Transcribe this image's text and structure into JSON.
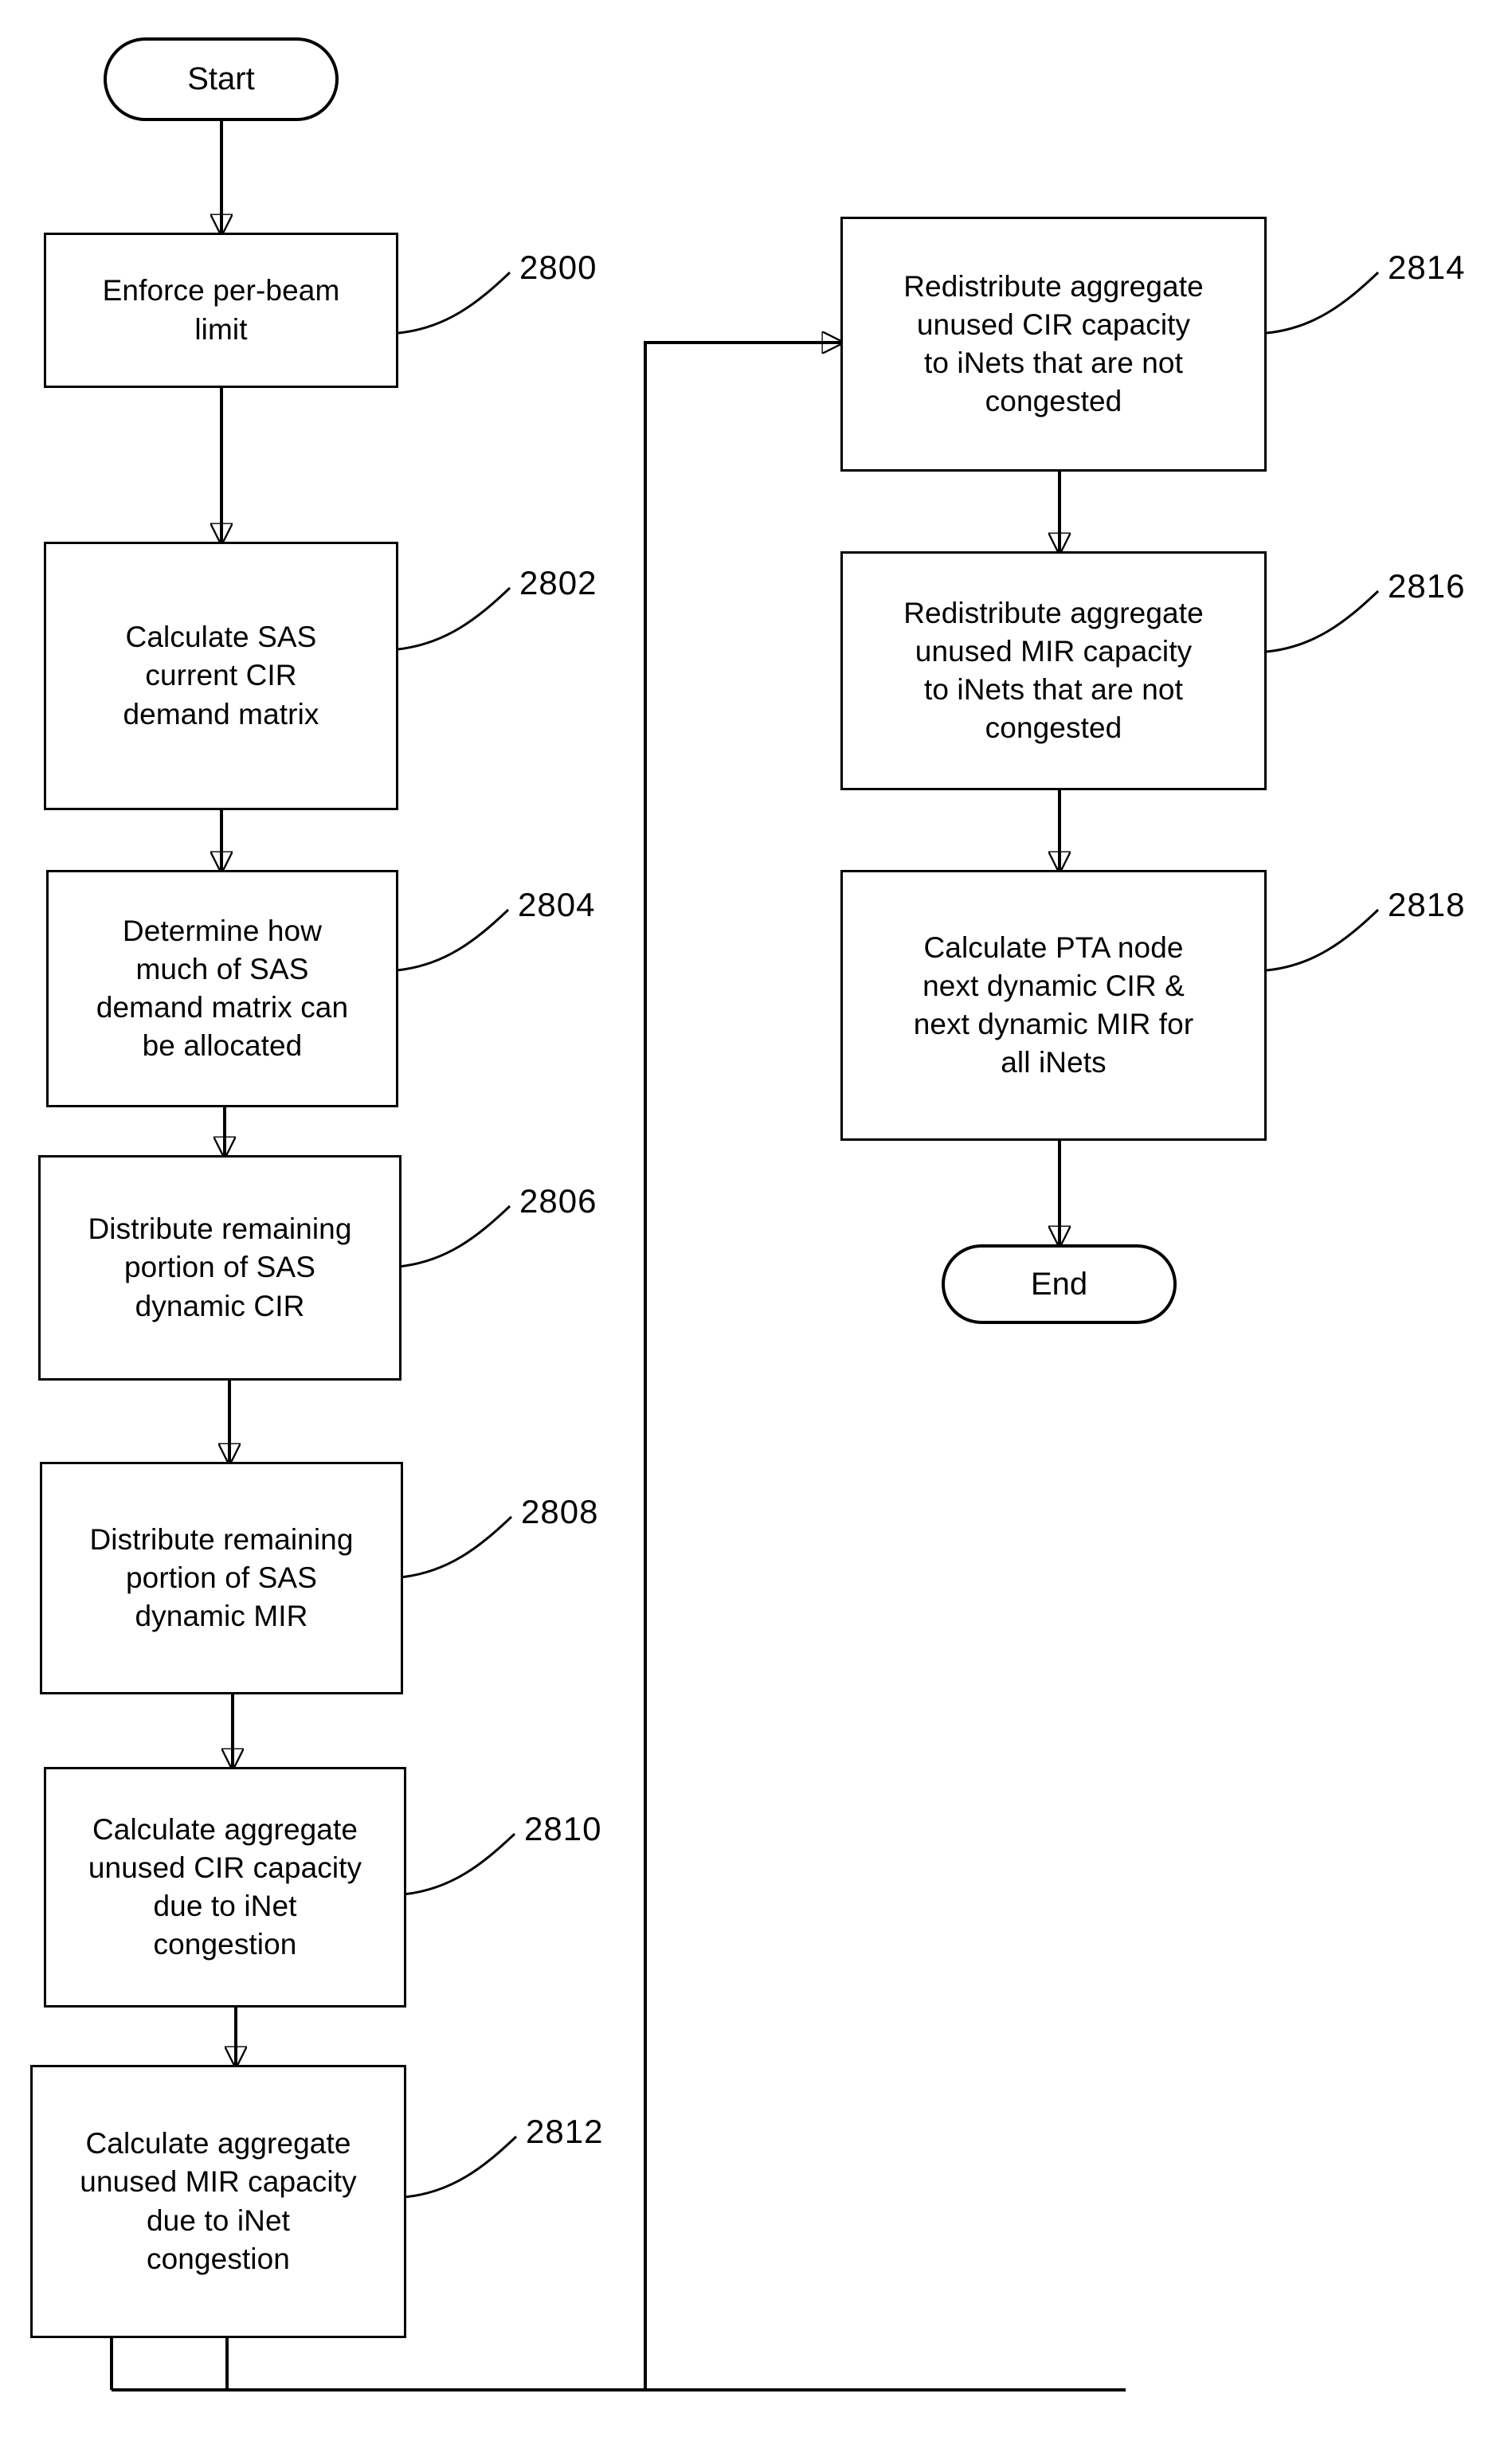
{
  "diagram": {
    "type": "flowchart",
    "title": "",
    "start_label": "Start",
    "end_label": "End",
    "left_column": [
      {
        "ref": "2800",
        "text": "Enforce per-beam\nlimit"
      },
      {
        "ref": "2802",
        "text": "Calculate SAS\ncurrent CIR\ndemand matrix"
      },
      {
        "ref": "2804",
        "text": "Determine how\nmuch of SAS\ndemand matrix can\nbe allocated"
      },
      {
        "ref": "2806",
        "text": "Distribute remaining\nportion of SAS\ndynamic CIR"
      },
      {
        "ref": "2808",
        "text": "Distribute remaining\nportion of SAS\ndynamic MIR"
      },
      {
        "ref": "2810",
        "text": "Calculate aggregate\nunused CIR capacity\ndue to iNet\ncongestion"
      },
      {
        "ref": "2812",
        "text": "Calculate aggregate\nunused MIR capacity\ndue to iNet\ncongestion"
      }
    ],
    "right_column": [
      {
        "ref": "2814",
        "text": "Redistribute aggregate\nunused CIR capacity\nto iNets that are not\ncongested"
      },
      {
        "ref": "2816",
        "text": "Redistribute aggregate\nunused MIR capacity\nto iNets that are not\ncongested"
      },
      {
        "ref": "2818",
        "text": "Calculate PTA node\nnext dynamic CIR &\nnext dynamic MIR for\nall iNets"
      }
    ],
    "colors": {
      "ink": "#000000",
      "paper": "#ffffff"
    }
  }
}
